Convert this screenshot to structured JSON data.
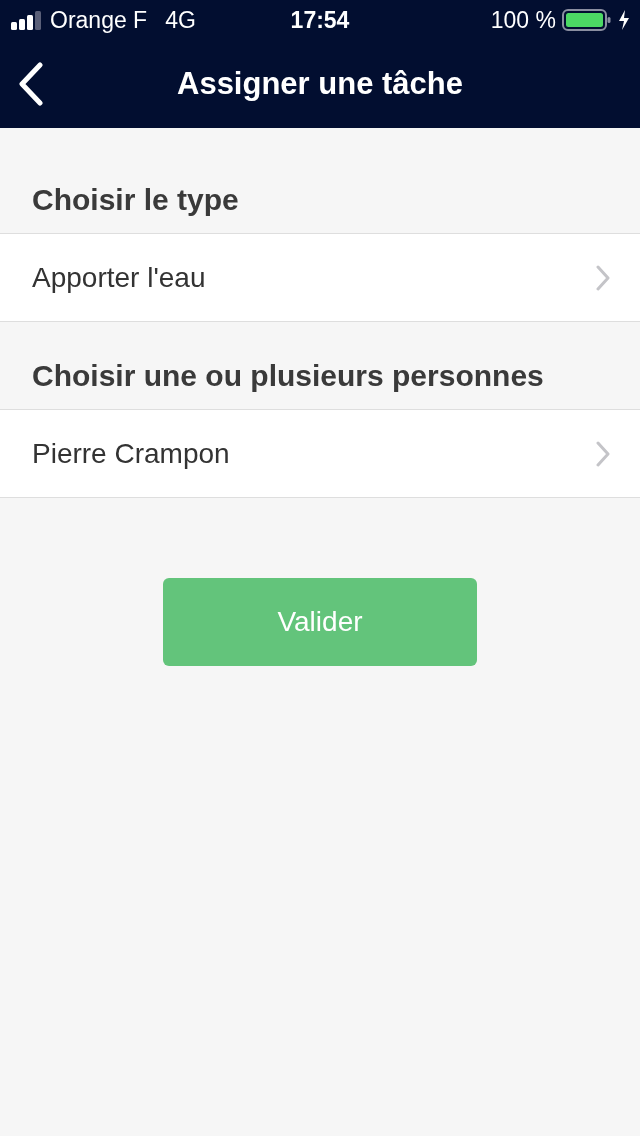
{
  "status_bar": {
    "carrier": "Orange F",
    "network": "4G",
    "time": "17:54",
    "battery": "100 %"
  },
  "nav_bar": {
    "title": "Assigner une tâche"
  },
  "sections": [
    {
      "heading": "Choisir le type",
      "value": "Apporter l'eau"
    },
    {
      "heading": "Choisir une ou plusieurs personnes",
      "value": "Pierre Crampon"
    }
  ],
  "submit_button": {
    "label": "Valider"
  }
}
